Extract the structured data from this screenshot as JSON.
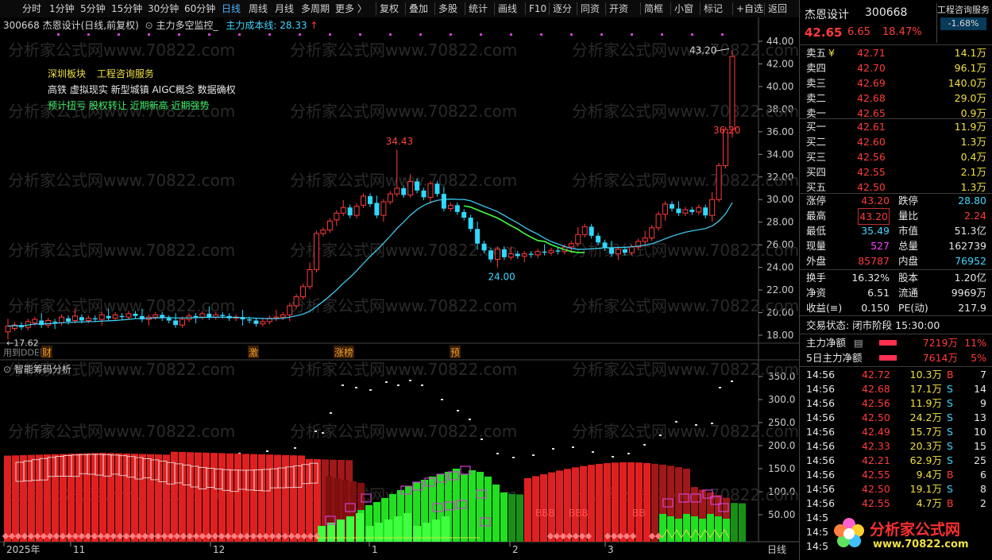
{
  "toolbar": {
    "items": [
      "分时",
      "1分钟",
      "5分钟",
      "15分钟",
      "30分钟",
      "60分钟",
      "日线",
      "周线",
      "月线",
      "多周期",
      "更多 〉"
    ],
    "active": "日线",
    "tools": [
      "复权",
      "叠加",
      "多股",
      "统计",
      "画线",
      "F10",
      "逐分",
      "同资",
      "开资",
      "简框",
      "小窗",
      "标记",
      "+自选",
      "返回"
    ]
  },
  "header": {
    "code_name": "300668 杰恩设计(日线,前复权)",
    "indicator": "主力多空监控_",
    "cost_line": "主力成本线: 28.33",
    "arrow": "↑"
  },
  "info": {
    "sector_line": [
      "深圳板块",
      "工程咨询服务"
    ],
    "concepts": "高铁 虚拟现实 新型城镇 AIGC概念 数据确权",
    "signals": "预计扭亏 股权转让 近期新高 近期强势"
  },
  "annotations": {
    "high_label": "34.43",
    "low_label": "24.00",
    "top_label": "43.20",
    "mid_label": "36.20",
    "left_low": "17.62",
    "dde_text": "用到DDE数",
    "markers": [
      "财",
      "激",
      "涨榜",
      "预"
    ]
  },
  "price_axis": [
    "44.00",
    "42.00",
    "40.00",
    "38.00",
    "36.00",
    "34.00",
    "32.00",
    "30.00",
    "28.00",
    "26.00",
    "24.00",
    "22.00",
    "20.00",
    "18.00"
  ],
  "lower": {
    "title": "智能筹码分析",
    "axis": [
      "350.0",
      "300.0",
      "250.0",
      "200.0",
      "150.0",
      "100.0",
      "50.00"
    ],
    "bbb": [
      "BBB",
      "BBB",
      "BB"
    ]
  },
  "date_axis": {
    "labels": [
      "2025年",
      "11",
      "12",
      "1",
      "2",
      "3"
    ],
    "period": "日线"
  },
  "watermark": "分析家公式网www.70822.com",
  "panel": {
    "name": "杰恩设计",
    "code": "300668",
    "price": "42.65",
    "change": "6.65",
    "pct": "18.47%",
    "industry": "工程咨询服务",
    "industry_pct": "-1.68%",
    "asks": [
      {
        "label": "卖五",
        "mark": "¥",
        "price": "42.71",
        "vol": "14.1万"
      },
      {
        "label": "卖四",
        "mark": "",
        "price": "42.70",
        "vol": "96.1万"
      },
      {
        "label": "卖三",
        "mark": "",
        "price": "42.69",
        "vol": "140.0万"
      },
      {
        "label": "卖二",
        "mark": "",
        "price": "42.68",
        "vol": "29.0万"
      },
      {
        "label": "卖一",
        "mark": "",
        "price": "42.65",
        "vol": "0.9万"
      }
    ],
    "bids": [
      {
        "label": "买一",
        "price": "42.61",
        "vol": "11.9万"
      },
      {
        "label": "买二",
        "price": "42.60",
        "vol": "1.3万"
      },
      {
        "label": "买三",
        "price": "42.56",
        "vol": "0.4万"
      },
      {
        "label": "买四",
        "price": "42.55",
        "vol": "2.1万"
      },
      {
        "label": "买五",
        "price": "42.50",
        "vol": "1.3万"
      }
    ],
    "stats": [
      {
        "l1": "涨停",
        "v1": "43.20",
        "c1": "red",
        "l2": "跌停",
        "v2": "28.80",
        "c2": "cyan"
      },
      {
        "l1": "最高",
        "v1": "43.20",
        "c1": "red",
        "l2": "量比",
        "v2": "2.24",
        "c2": "red"
      },
      {
        "l1": "最低",
        "v1": "35.49",
        "c1": "cyan",
        "l2": "市值",
        "v2": "51.3亿",
        "c2": "white"
      },
      {
        "l1": "现量",
        "v1": "527",
        "c1": "mag",
        "l2": "总量",
        "v2": "162739",
        "c2": "white"
      },
      {
        "l1": "外盘",
        "v1": "85787",
        "c1": "red",
        "l2": "内盘",
        "v2": "76952",
        "c2": "cyan"
      }
    ],
    "stats2": [
      {
        "l1": "换手",
        "v1": "16.32%",
        "l2": "股本",
        "v2": "1.20亿"
      },
      {
        "l1": "净资",
        "v1": "6.51",
        "l2": "流通",
        "v2": "9969万"
      },
      {
        "l1": "收益(≡)",
        "v1": "0.150",
        "l2": "PE(动)",
        "v2": "217.9"
      }
    ],
    "trade_status": "交易状态: 闭市阶段 15:30:00",
    "flow": [
      {
        "label": "主力净额",
        "amount": "7219万",
        "pct": "11%"
      },
      {
        "label": "5日主力净额",
        "amount": "7614万",
        "pct": "5%"
      }
    ],
    "ticks": [
      {
        "t": "14:56",
        "p": "42.72",
        "v": "10.3万",
        "s": "B",
        "n": "7"
      },
      {
        "t": "14:56",
        "p": "42.68",
        "v": "17.1万",
        "s": "S",
        "n": "14"
      },
      {
        "t": "14:56",
        "p": "42.56",
        "v": "11.9万",
        "s": "S",
        "n": "9"
      },
      {
        "t": "14:56",
        "p": "42.50",
        "v": "24.2万",
        "s": "S",
        "n": "13"
      },
      {
        "t": "14:56",
        "p": "42.49",
        "v": "15.7万",
        "s": "S",
        "n": "10"
      },
      {
        "t": "14:56",
        "p": "42.33",
        "v": "20.3万",
        "s": "S",
        "n": "15"
      },
      {
        "t": "14:56",
        "p": "42.21",
        "v": "62.9万",
        "s": "S",
        "n": "25"
      },
      {
        "t": "14:56",
        "p": "42.55",
        "v": "9.4万",
        "s": "B",
        "n": "6"
      },
      {
        "t": "14:56",
        "p": "42.50",
        "v": "19.1万",
        "s": "S",
        "n": "8"
      },
      {
        "t": "14:56",
        "p": "42.55",
        "v": "4.7万",
        "s": "B",
        "n": "2"
      }
    ],
    "cut_rows": [
      "14:5",
      "14:5",
      "14:5"
    ],
    "logo_text": "分析家公式网",
    "logo_url": "www.70822.com"
  }
}
